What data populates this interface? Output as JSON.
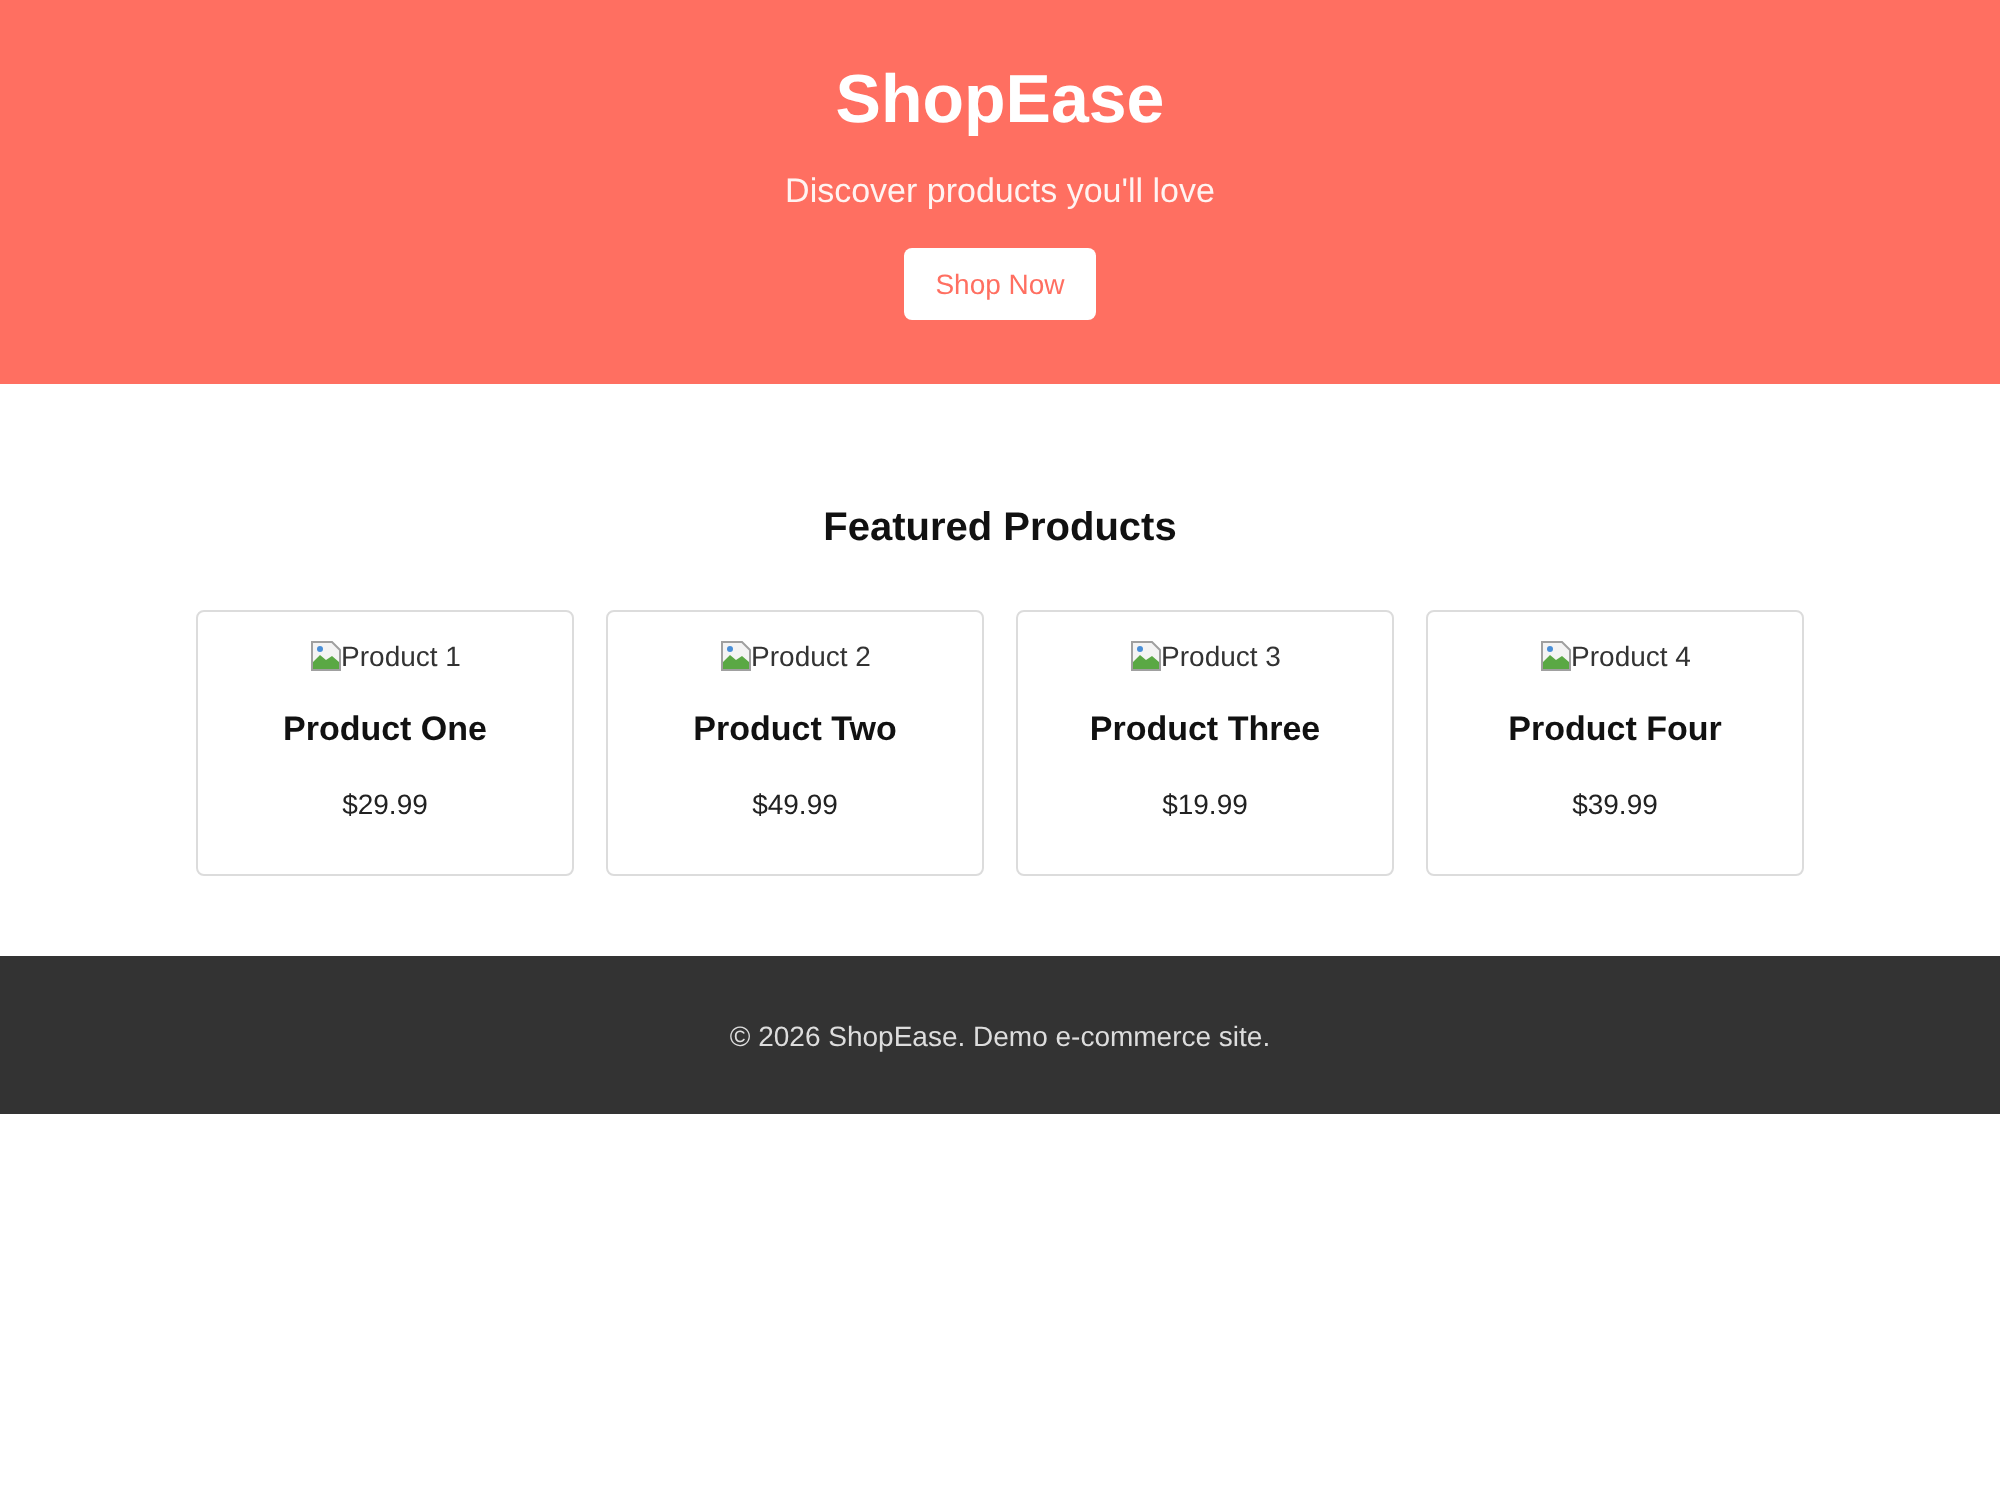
{
  "header": {
    "title": "ShopEase",
    "tagline": "Discover products you'll love",
    "button": "Shop Now"
  },
  "featured": {
    "heading": "Featured Products",
    "products": [
      {
        "image_alt": "Product 1",
        "name": "Product One",
        "price": "$29.99"
      },
      {
        "image_alt": "Product 2",
        "name": "Product Two",
        "price": "$49.99"
      },
      {
        "image_alt": "Product 3",
        "name": "Product Three",
        "price": "$19.99"
      },
      {
        "image_alt": "Product 4",
        "name": "Product Four",
        "price": "$39.99"
      }
    ]
  },
  "footer": {
    "text": "© 2026 ShopEase. Demo e-commerce site."
  }
}
